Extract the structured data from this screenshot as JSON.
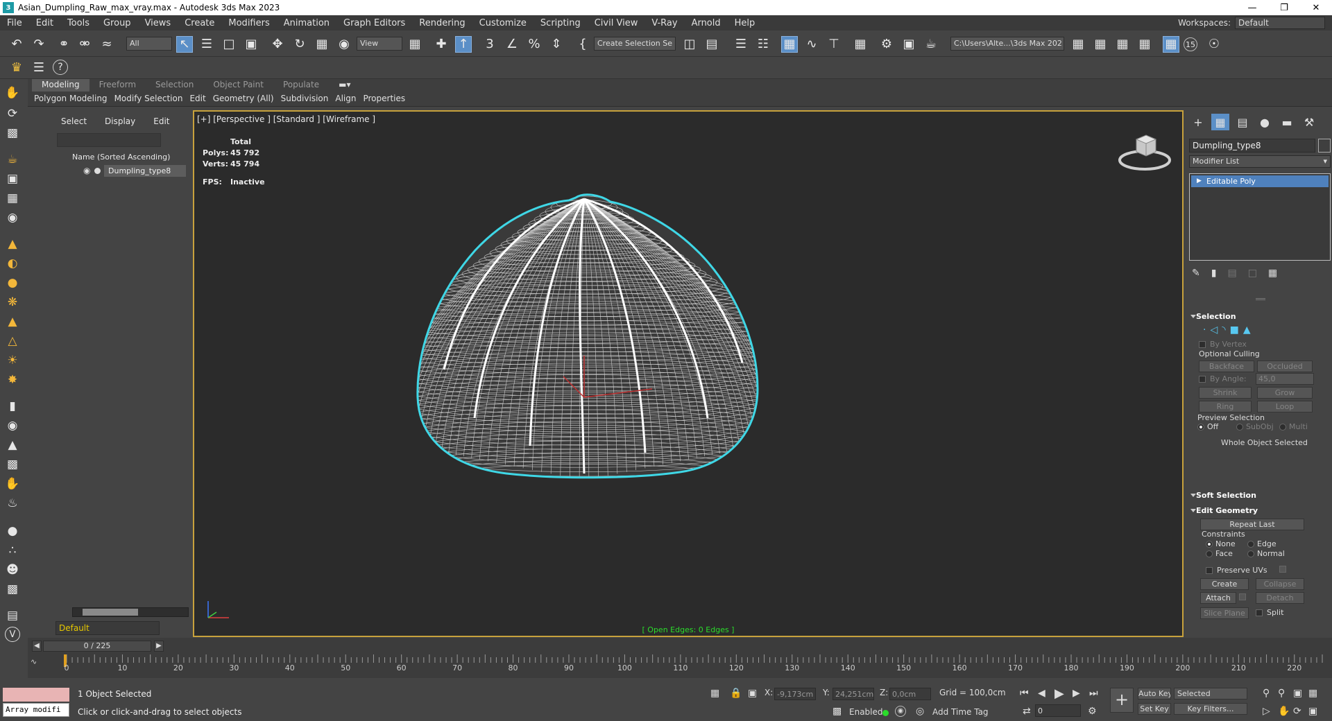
{
  "window": {
    "title": "Asian_Dumpling_Raw_max_vray.max - Autodesk 3ds Max 2023",
    "app_icon": "3"
  },
  "menu": {
    "items": [
      "File",
      "Edit",
      "Tools",
      "Group",
      "Views",
      "Create",
      "Modifiers",
      "Animation",
      "Graph Editors",
      "Rendering",
      "Customize",
      "Scripting",
      "Civil View",
      "V-Ray",
      "Arnold",
      "Help"
    ],
    "workspaces_label": "Workspaces:",
    "workspace_value": "Default"
  },
  "toolbar": {
    "selection_filter": "All",
    "reference_coord": "View",
    "named_selection": "Create Selection Se",
    "project_path": "C:\\Users\\Alte...\\3ds Max 202",
    "badge_number": "15"
  },
  "ribbon": {
    "tabs": [
      "Modeling",
      "Freeform",
      "Selection",
      "Object Paint",
      "Populate"
    ],
    "subtabs": [
      "Polygon Modeling",
      "Modify Selection",
      "Edit",
      "Geometry (All)",
      "Subdivision",
      "Align",
      "Properties"
    ]
  },
  "scene_explorer": {
    "menu": [
      "Select",
      "Display",
      "Edit"
    ],
    "column_header": "Name (Sorted Ascending)",
    "object_name": "Dumpling_type8",
    "layer": "Default"
  },
  "viewport": {
    "label": "[+] [Perspective ] [Standard ] [Wireframe ]",
    "stats_header": "Total",
    "polys_label": "Polys:",
    "polys_value": "45 792",
    "verts_label": "Verts:",
    "verts_value": "45 794",
    "fps_label": "FPS:",
    "fps_value": "Inactive",
    "open_edges": "[ Open Edges: 0 Edges ]"
  },
  "command_panel": {
    "object_name": "Dumpling_type8",
    "modifier_list": "Modifier List",
    "stack_item": "Editable Poly",
    "selection": {
      "title": "Selection",
      "by_vertex": "By Vertex",
      "optional_culling": "Optional Culling",
      "backface": "Backface",
      "occluded": "Occluded",
      "by_angle": "By Angle:",
      "by_angle_value": "45,0",
      "shrink": "Shrink",
      "grow": "Grow",
      "ring": "Ring",
      "loop": "Loop",
      "preview_selection": "Preview Selection",
      "off": "Off",
      "subobj": "SubObj",
      "multi": "Multi",
      "whole_object": "Whole Object Selected"
    },
    "soft_selection": {
      "title": "Soft Selection"
    },
    "edit_geometry": {
      "title": "Edit Geometry",
      "repeat_last": "Repeat Last",
      "constraints": "Constraints",
      "none": "None",
      "edge": "Edge",
      "face": "Face",
      "normal": "Normal",
      "preserve_uvs": "Preserve UVs",
      "create": "Create",
      "collapse": "Collapse",
      "attach": "Attach",
      "detach": "Detach",
      "slice_plane": "Slice Plane",
      "split": "Split"
    }
  },
  "timeline": {
    "frame_display": "0 / 225",
    "tick_labels": [
      "0",
      "10",
      "20",
      "30",
      "40",
      "50",
      "60",
      "70",
      "80",
      "90",
      "100",
      "110",
      "120",
      "130",
      "140",
      "150",
      "160",
      "170",
      "180",
      "190",
      "200",
      "210",
      "220"
    ]
  },
  "status": {
    "maxscript_input": "Array modifi",
    "selected_msg": "1 Object Selected",
    "prompt_msg": "Click or click-and-drag to select objects",
    "x_label": "X:",
    "x_value": "-9,173cm",
    "y_label": "Y:",
    "y_value": "24,251cm",
    "z_label": "Z:",
    "z_value": "0,0cm",
    "grid": "Grid = 100,0cm",
    "enabled_label": "Enabled:",
    "add_time_tag": "Add Time Tag",
    "auto_key": "Auto Key",
    "set_key": "Set Key",
    "selected_dd": "Selected",
    "key_filters": "Key Filters...",
    "frame_value": "0"
  },
  "colors": {
    "selection_highlight": "#4f81bd",
    "viewport_border": "#c8a23c",
    "wire_outline": "#3fd7e6",
    "open_edges_text": "#2bdd2b"
  }
}
